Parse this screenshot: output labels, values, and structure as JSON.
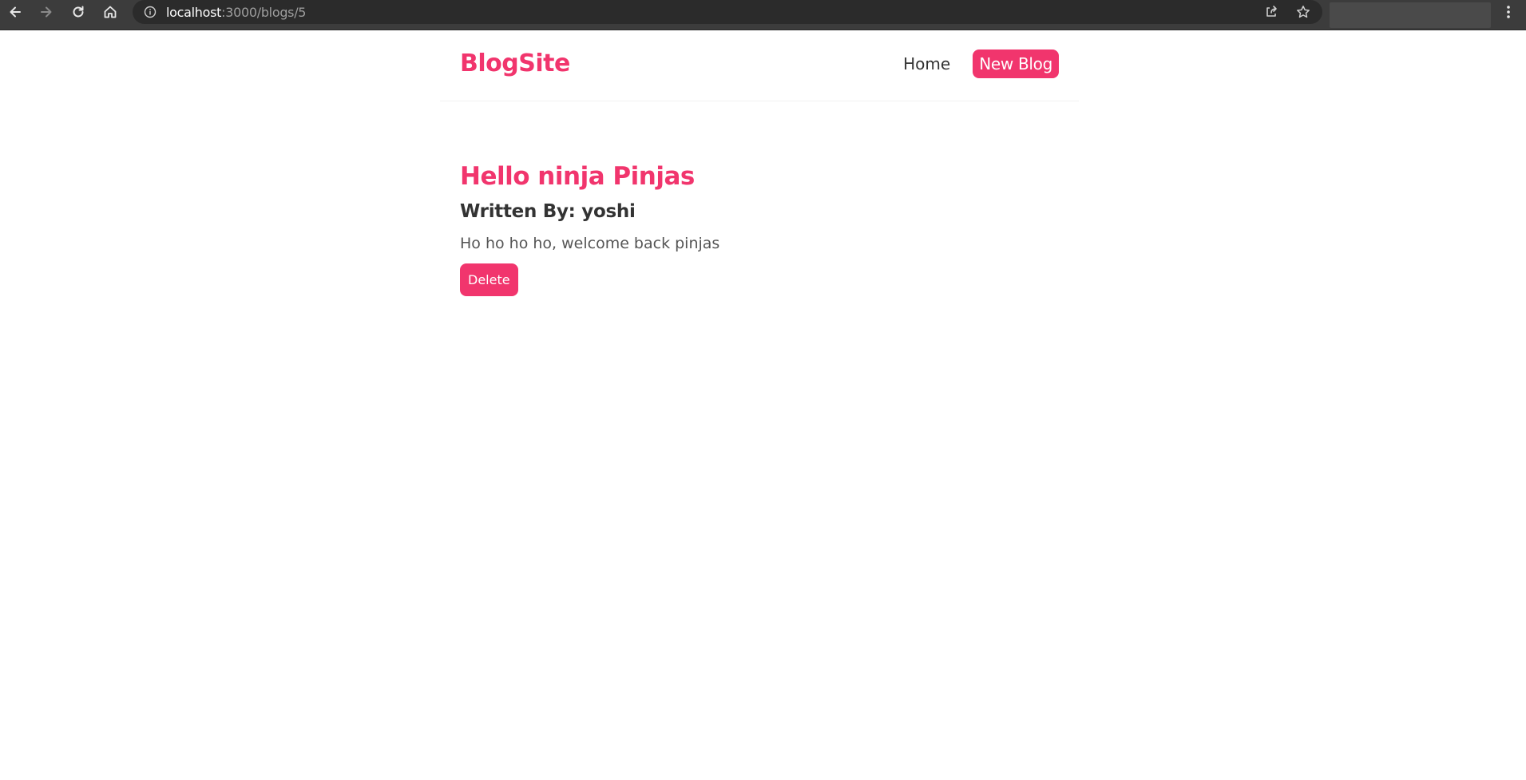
{
  "browser": {
    "url_host": "localhost",
    "url_path": ":3000/blogs/5",
    "icons": [
      "back-arrow-icon",
      "forward-arrow-icon",
      "reload-icon",
      "home-icon",
      "info-icon",
      "share-icon",
      "star-icon",
      "kebab-menu-icon"
    ]
  },
  "navbar": {
    "brand": "BlogSite",
    "links": {
      "home": "Home",
      "new_blog": "New Blog"
    }
  },
  "blog": {
    "title": "Hello ninja Pinjas",
    "author": "Written By: yoshi",
    "body": "Ho ho ho ho, welcome back pinjas",
    "delete_label": "Delete"
  },
  "colors": {
    "accent": "#f1356d",
    "text_dark": "#333333",
    "browser_bar": "#3c3c3c"
  }
}
